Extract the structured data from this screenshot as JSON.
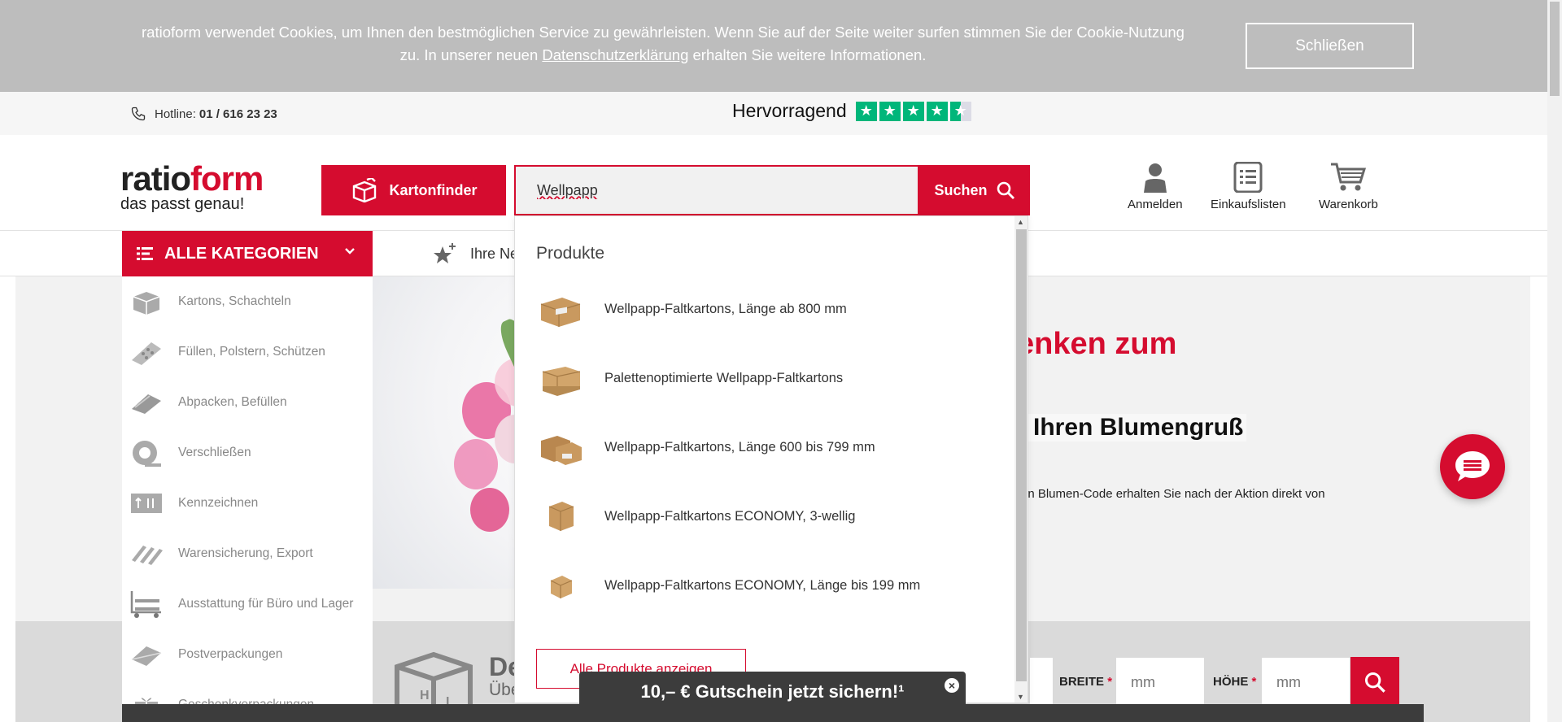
{
  "cookie": {
    "text_before": "ratioform verwendet Cookies, um Ihnen den bestmöglichen Service zu gewährleisten. Wenn Sie auf der Seite weiter surfen stimmen Sie der Cookie-Nutzung zu. In unserer neuen ",
    "link": "Datenschutzerklärung",
    "text_after": " erhalten Sie weitere Informationen.",
    "close_label": "Schließen"
  },
  "topbar": {
    "hotline_label": "Hotline:",
    "hotline_number": "01 / 616 23 23",
    "rating_label": "Hervorragend",
    "rating_stars": 4.5
  },
  "header": {
    "logo_main_a": "ratio",
    "logo_main_b": "form",
    "logo_sub": "das passt genau!",
    "kartonfinder_label": "Kartonfinder",
    "search_value": "Wellpapp",
    "search_button": "Suchen",
    "login_label": "Anmelden",
    "lists_label": "Einkaufslisten",
    "cart_label": "Warenkorb"
  },
  "nav": {
    "all_categories": "ALLE KATEGORIEN",
    "news_label": "Ihre Ne"
  },
  "sidebar": {
    "items": [
      {
        "label": "Kartons, Schachteln",
        "icon": "box-icon"
      },
      {
        "label": "Füllen, Polstern, Schützen",
        "icon": "bubble-wrap-icon"
      },
      {
        "label": "Abpacken, Befüllen",
        "icon": "bag-icon"
      },
      {
        "label": "Verschließen",
        "icon": "tape-icon"
      },
      {
        "label": "Kennzeichnen",
        "icon": "label-icon"
      },
      {
        "label": "Warensicherung, Export",
        "icon": "pallet-icon"
      },
      {
        "label": "Ausstattung für Büro und Lager",
        "icon": "trolley-icon"
      },
      {
        "label": "Postverpackungen",
        "icon": "envelope-icon"
      },
      {
        "label": "Geschenkverpackungen",
        "icon": "gift-icon"
      }
    ]
  },
  "dropdown": {
    "heading": "Produkte",
    "items": [
      {
        "title": "Wellpapp-Faltkartons, Länge ab 800 mm"
      },
      {
        "title": "Palettenoptimierte Wellpapp-Faltkartons"
      },
      {
        "title": "Wellpapp-Faltkartons, Länge 600 bis 799 mm"
      },
      {
        "title": "Wellpapp-Faltkartons ECONOMY, 3-wellig"
      },
      {
        "title": "Wellpapp-Faltkartons ECONOMY, Länge bis 199 mm"
      }
    ],
    "all_button": "Alle Produkte anzeigen"
  },
  "hero": {
    "title": "enken zum",
    "subtitle": "r Ihren Blumengruß",
    "small": "ren Blumen-Code erhalten Sie nach der Aktion direkt von"
  },
  "kartonfinder_bar": {
    "heading": "De",
    "sub": "Übe",
    "breite_label": "BREITE",
    "hoehe_label": "HÖHE",
    "required_mark": "*",
    "mm_placeholder": "mm"
  },
  "voucher": {
    "text": "10,– € Gutschein jetzt sichern!¹",
    "close": "×"
  },
  "colors": {
    "brand_red": "#d50c2f",
    "trustpilot_green": "#00b67a"
  }
}
